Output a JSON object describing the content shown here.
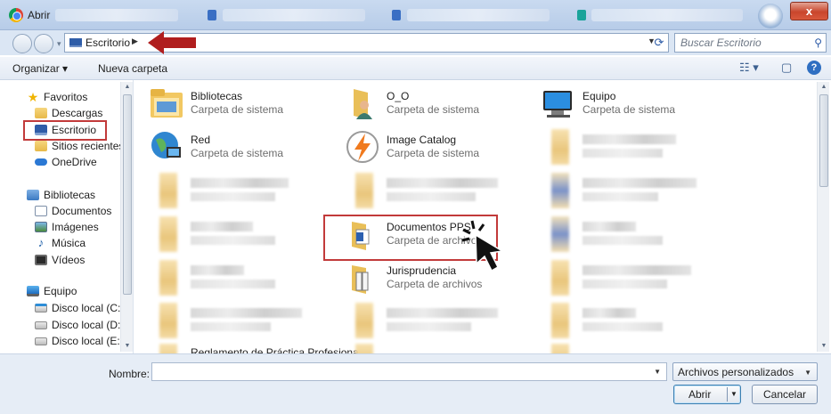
{
  "window": {
    "title": "Abrir",
    "close_label": "x"
  },
  "address": {
    "location": "Escritorio",
    "search_placeholder": "Buscar Escritorio"
  },
  "toolbar": {
    "organize_label": "Organizar",
    "new_folder_label": "Nueva carpeta"
  },
  "sidebar": {
    "favorites_label": "Favoritos",
    "favorites": [
      "Descargas",
      "Escritorio",
      "Sitios recientes",
      "OneDrive"
    ],
    "libraries_label": "Bibliotecas",
    "libraries": [
      "Documentos",
      "Imágenes",
      "Música",
      "Vídeos"
    ],
    "computer_label": "Equipo",
    "drives": [
      "Disco local (C:)",
      "Disco local (D:)",
      "Disco local (E:)"
    ]
  },
  "items": [
    {
      "name": "Bibliotecas",
      "type": "Carpeta de sistema",
      "icon": "libraries-icon"
    },
    {
      "name": "O_O",
      "type": "Carpeta de sistema",
      "icon": "user-folder-icon"
    },
    {
      "name": "Equipo",
      "type": "Carpeta de sistema",
      "icon": "computer-icon"
    },
    {
      "name": "Red",
      "type": "Carpeta de sistema",
      "icon": "network-icon"
    },
    {
      "name": "Image Catalog",
      "type": "Carpeta de sistema",
      "icon": "image-catalog-icon"
    },
    {
      "name": "Documentos PPS",
      "type": "Carpeta de archivos",
      "icon": "word-folder-icon"
    },
    {
      "name": "Jurisprudencia",
      "type": "Carpeta de archivos",
      "icon": "book-folder-icon"
    },
    {
      "name": "Reglamento de Práctica Profesional",
      "type": "",
      "icon": "folder-icon"
    }
  ],
  "bottom": {
    "filename_label": "Nombre:",
    "filename_value": "",
    "filter_value": "Archivos personalizados",
    "open_label": "Abrir",
    "cancel_label": "Cancelar"
  },
  "colors": {
    "highlight": "#c23a3a",
    "annotation_arrow": "#b01e1e"
  }
}
